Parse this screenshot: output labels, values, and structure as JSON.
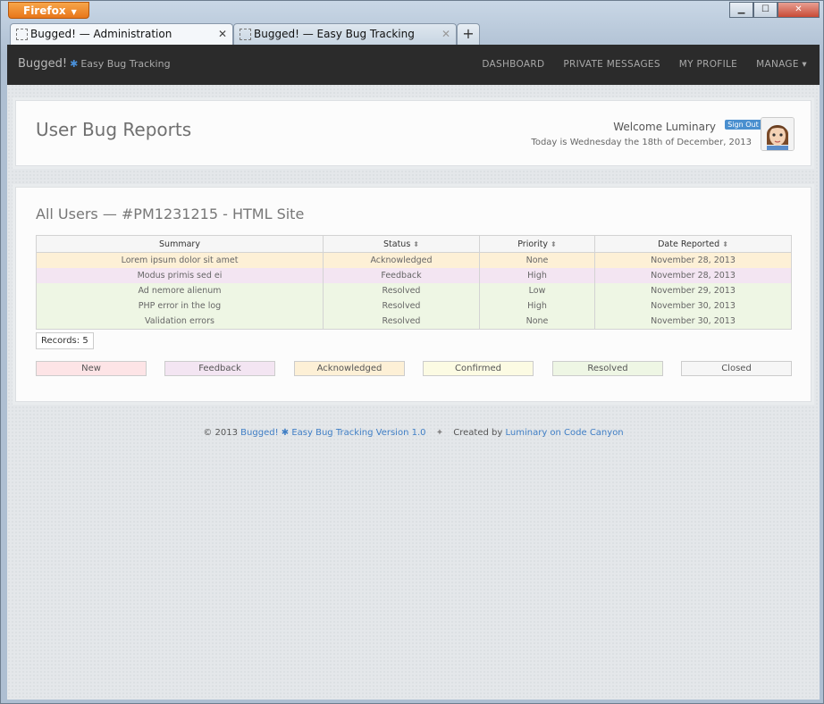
{
  "window": {
    "menu_button": "Firefox",
    "controls": [
      "▁",
      "☐",
      "✕"
    ]
  },
  "tabs": [
    {
      "label": "Bugged! — Administration",
      "active": true
    },
    {
      "label": "Bugged! — Easy Bug Tracking",
      "active": false
    }
  ],
  "newtab_label": "+",
  "navbar": {
    "brand": "Bugged!",
    "brand_sub": "Easy Bug Tracking",
    "links": [
      "DASHBOARD",
      "PRIVATE MESSAGES",
      "MY PROFILE",
      "MANAGE ▾"
    ]
  },
  "header": {
    "title": "User Bug Reports",
    "welcome": "Welcome Luminary",
    "signout": "Sign Out ⇨",
    "today": "Today is Wednesday the 18th of December, 2013"
  },
  "report": {
    "title": "All Users — #PM1231215 - HTML Site",
    "columns": [
      "Summary",
      "Status",
      "Priority",
      "Date Reported"
    ],
    "rows": [
      {
        "summary": "Lorem ipsum dolor sit amet",
        "status": "Acknowledged",
        "priority": "None",
        "date": "November 28, 2013",
        "color": "#fdf0d6"
      },
      {
        "summary": "Modus primis sed ei",
        "status": "Feedback",
        "priority": "High",
        "date": "November 28, 2013",
        "color": "#f3e5f2"
      },
      {
        "summary": "Ad nemore alienum",
        "status": "Resolved",
        "priority": "Low",
        "date": "November 29, 2013",
        "color": "#eef6e4"
      },
      {
        "summary": "PHP error in the log",
        "status": "Resolved",
        "priority": "High",
        "date": "November 30, 2013",
        "color": "#eef6e4"
      },
      {
        "summary": "Validation errors",
        "status": "Resolved",
        "priority": "None",
        "date": "November 30, 2013",
        "color": "#eef6e4"
      }
    ],
    "records_label": "Records:",
    "records_count": "5"
  },
  "legend": [
    {
      "label": "New",
      "color": "#fde4e6"
    },
    {
      "label": "Feedback",
      "color": "#f3e5f2"
    },
    {
      "label": "Acknowledged",
      "color": "#fdf0d6"
    },
    {
      "label": "Confirmed",
      "color": "#fcfbe3"
    },
    {
      "label": "Resolved",
      "color": "#eef6e4"
    },
    {
      "label": "Closed",
      "color": "#f6f6f6"
    }
  ],
  "footer": {
    "copyright": "© 2013",
    "app_link": "Bugged!",
    "app_link_rest": "Easy Bug Tracking Version 1.0",
    "separator": "✦",
    "created_by": "Created by",
    "author_link": "Luminary on Code Canyon"
  }
}
